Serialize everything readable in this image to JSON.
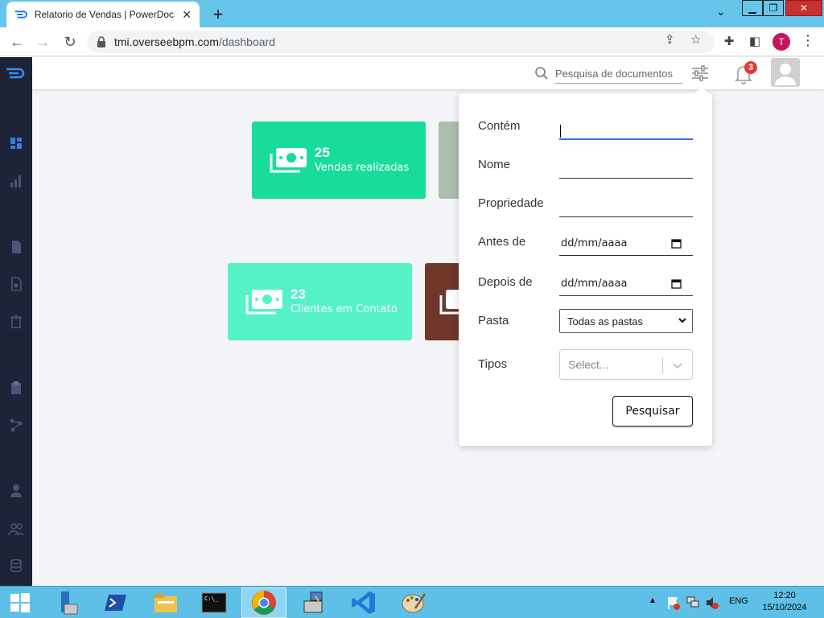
{
  "browser": {
    "tab_title": "Relatorio de Vendas | PowerDoc",
    "url_host": "tmi.overseebpm.com",
    "url_path": "/dashboard",
    "profile_initial": "T"
  },
  "header": {
    "search_placeholder": "Pesquisa de documentos",
    "notification_count": "3"
  },
  "cards": [
    {
      "value": "25",
      "label": "Vendas realizadas",
      "color": "#18dd98"
    },
    {
      "value": "23",
      "label": "Clientes em Contato",
      "color": "#56f2c7"
    }
  ],
  "filter": {
    "contains_label": "Contém",
    "contains_value": "",
    "name_label": "Nome",
    "name_value": "",
    "property_label": "Propriedade",
    "property_value": "",
    "before_label": "Antes de",
    "before_value": "dd/mm/aaaa",
    "after_label": "Depois de",
    "after_value": "dd/mm/aaaa",
    "folder_label": "Pasta",
    "folder_selected": "Todas as pastas",
    "types_label": "Tipos",
    "types_placeholder": "Select...",
    "submit_label": "Pesquisar"
  },
  "taskbar": {
    "language": "ENG",
    "time": "12:20",
    "date": "15/10/2024"
  },
  "colors": {
    "sidebar": "#1e2437",
    "accent_blue": "#3f6fd6",
    "badge_red": "#e53935",
    "card_gray": "#adbdad",
    "card_brown": "#6e3728"
  }
}
